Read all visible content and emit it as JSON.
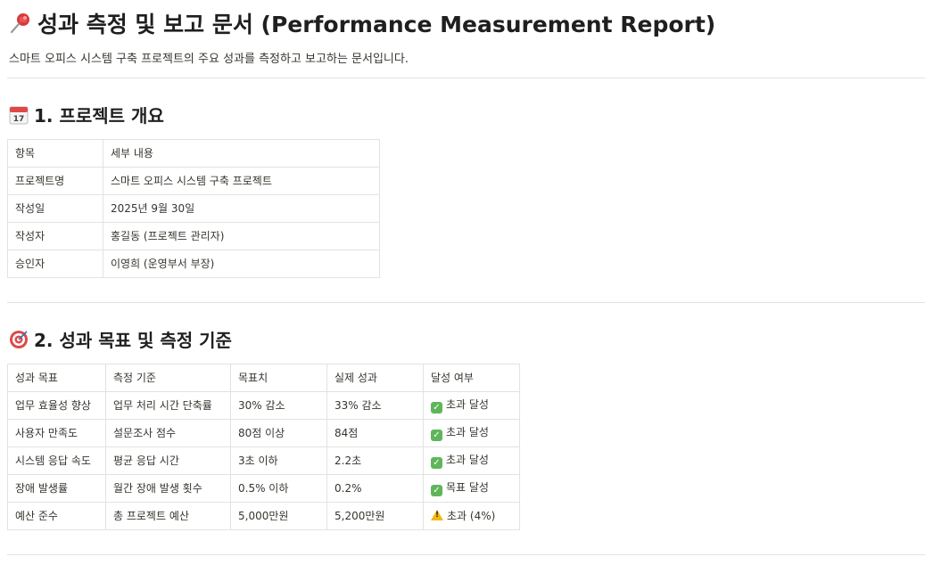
{
  "header": {
    "title_icon": "pushpin-icon",
    "title": "성과 측정 및 보고 문서 (Performance Measurement Report)",
    "description": "스마트 오피스 시스템 구축 프로젝트의 주요 성과를 측정하고 보고하는 문서입니다."
  },
  "section1": {
    "icon": "calendar-icon",
    "title": "1. 프로젝트 개요",
    "table": {
      "headers": [
        "항목",
        "세부 내용"
      ],
      "rows": [
        [
          "프로젝트명",
          "스마트 오피스 시스템 구축 프로젝트"
        ],
        [
          "작성일",
          "2025년 9월 30일"
        ],
        [
          "작성자",
          "홍길동 (프로젝트 관리자)"
        ],
        [
          "승인자",
          "이영희 (운영부서 부장)"
        ]
      ]
    }
  },
  "section2": {
    "icon": "target-icon",
    "title": "2. 성과 목표 및 측정 기준",
    "table": {
      "headers": [
        "성과 목표",
        "측정 기준",
        "목표치",
        "실제 성과",
        "달성 여부"
      ],
      "rows": [
        [
          "업무 효율성 향상",
          "업무 처리 시간 단축률",
          "30% 감소",
          "33% 감소",
          "초과 달성"
        ],
        [
          "사용자 만족도",
          "설문조사 점수",
          "80점 이상",
          "84점",
          "초과 달성"
        ],
        [
          "시스템 응답 속도",
          "평균 응답 시간",
          "3초 이하",
          "2.2초",
          "초과 달성"
        ],
        [
          "장애 발생률",
          "월간 장애 발생 횟수",
          "0.5% 이하",
          "0.2%",
          "목표 달성"
        ],
        [
          "예산 준수",
          "총 프로젝트 예산",
          "5,000만원",
          "5,200만원",
          "초과 (4%)"
        ]
      ],
      "status_icons": [
        "check-icon",
        "check-icon",
        "check-icon",
        "check-icon",
        "warning-icon"
      ]
    }
  },
  "colors": {
    "divider": "#e3e2e0",
    "check": "#5fb65a",
    "warning": "#f2b816"
  }
}
